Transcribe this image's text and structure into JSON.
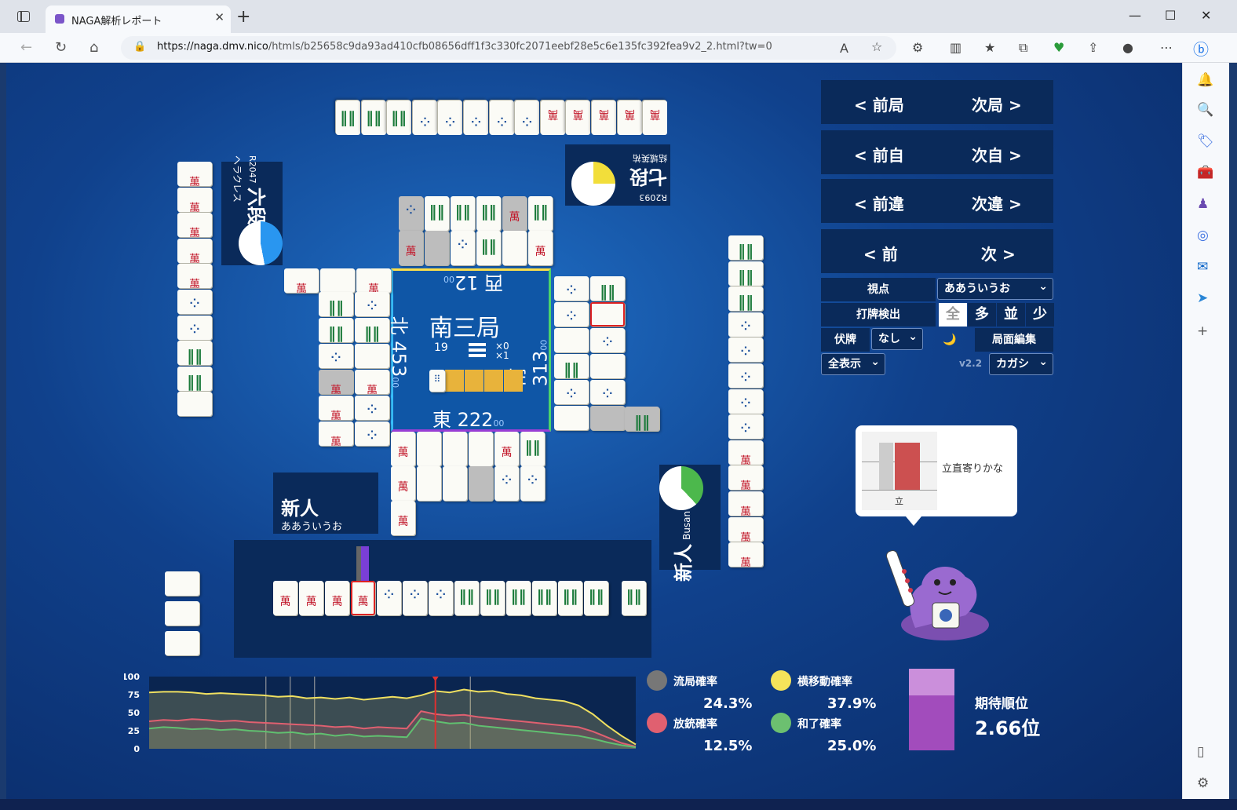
{
  "browser": {
    "tab_title": "NAGA解析レポート",
    "url_host": "https://naga.dmv.nico",
    "url_path": "/htmls/b25658c9da93ad410cfb08656dff1f3c330fc2071eebf28e5c6e135fc392fea9v2_2.html?tw=0"
  },
  "table": {
    "round_name": "南三局",
    "honba": "19",
    "sticks_a": "×0",
    "sticks_b": "×1",
    "scores": {
      "top": {
        "value": "西 12",
        "sub": "00"
      },
      "left": {
        "value": "北 453",
        "sub": "00"
      },
      "right": {
        "value": "南 313",
        "sub": "00"
      },
      "bottom": {
        "value": "東 222",
        "sub": "00"
      }
    }
  },
  "players": {
    "left": {
      "rank": "六段",
      "rating": "R2047",
      "name": "ヘラクレス"
    },
    "top": {
      "rank": "七段",
      "rating": "R2093",
      "name": "結城英祐"
    },
    "right": {
      "rank": "新人",
      "name": "Busan"
    },
    "self": {
      "rank": "新人",
      "name": "ああういうお"
    }
  },
  "controls": {
    "prev_round": "< 前局",
    "next_round": "次局 >",
    "prev_self": "< 前自",
    "next_self": "次自 >",
    "prev_diff": "< 前違",
    "next_diff": "次違 >",
    "prev": "< 前",
    "next": "次 >",
    "viewpoint_label": "視点",
    "viewpoint_value": "ああういうお",
    "detect_label": "打牌検出",
    "detect_options": [
      "全",
      "多",
      "並",
      "少"
    ],
    "hidden_label": "伏牌",
    "hidden_value": "なし",
    "moon_icon": "🌙",
    "edit_label": "局面編集",
    "display_value": "全表示",
    "version": "v2.2",
    "voice_value": "カガシ"
  },
  "advice": {
    "text": "立直寄りかな",
    "bar_label": "立"
  },
  "stats": {
    "ryukyoku_label": "流局確率",
    "ryukyoku_value": "24.3%",
    "yoko_label": "横移動確率",
    "yoko_value": "37.9%",
    "houju_label": "放銃確率",
    "houju_value": "12.5%",
    "agari_label": "和了確率",
    "agari_value": "25.0%",
    "expected_label": "期待順位",
    "expected_value": "2.66位"
  },
  "chart_data": {
    "type": "area",
    "ylim": [
      0,
      100
    ],
    "yticks": [
      "100",
      "75",
      "50",
      "25",
      "0"
    ],
    "series": [
      {
        "color": "#f0e060",
        "values": [
          78,
          79,
          79,
          78,
          76,
          77,
          76,
          75,
          74,
          72,
          73,
          70,
          71,
          69,
          71,
          68,
          70,
          72,
          70,
          74,
          80,
          78,
          82,
          79,
          80,
          76,
          74,
          70,
          68,
          66,
          60,
          48,
          32,
          18,
          6
        ]
      },
      {
        "color": "#e06070",
        "values": [
          38,
          40,
          39,
          41,
          40,
          38,
          39,
          37,
          36,
          35,
          34,
          33,
          32,
          30,
          31,
          28,
          30,
          29,
          28,
          52,
          48,
          46,
          47,
          44,
          42,
          40,
          38,
          36,
          34,
          32,
          30,
          24,
          16,
          8,
          3
        ]
      },
      {
        "color": "#60c070",
        "values": [
          28,
          30,
          29,
          27,
          28,
          26,
          27,
          25,
          24,
          22,
          23,
          20,
          21,
          18,
          20,
          17,
          18,
          17,
          16,
          42,
          38,
          35,
          36,
          32,
          30,
          28,
          26,
          24,
          22,
          20,
          18,
          14,
          9,
          5,
          2
        ]
      }
    ],
    "current_index": 20
  }
}
